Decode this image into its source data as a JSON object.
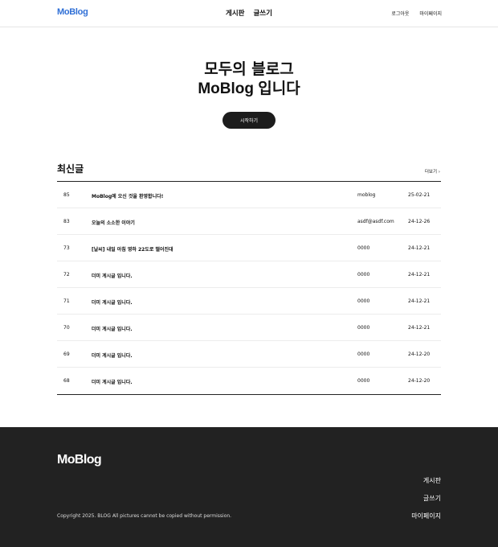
{
  "header": {
    "logo": "MoBlog",
    "nav": [
      "게시판",
      "글쓰기"
    ],
    "auth": [
      "로그아웃",
      "마이페이지"
    ]
  },
  "hero": {
    "line1": "모두의 블로그",
    "line2": "MoBlog 입니다",
    "button": "시작하기"
  },
  "recent": {
    "title": "최신글",
    "more": "더보기 ›",
    "posts": [
      {
        "num": "85",
        "title": "MoBlog에 오신 것을 환영합니다!",
        "author": "moblog",
        "date": "25-02-21"
      },
      {
        "num": "83",
        "title": "오늘의 소소한 이야기",
        "author": "asdf@asdf.com",
        "date": "24-12-26"
      },
      {
        "num": "73",
        "title": "[날씨] 내일 아침 영하 22도로 떨어진대",
        "author": "0000",
        "date": "24-12-21"
      },
      {
        "num": "72",
        "title": "더미 게시글 입니다.",
        "author": "0000",
        "date": "24-12-21"
      },
      {
        "num": "71",
        "title": "더미 게시글 입니다.",
        "author": "0000",
        "date": "24-12-21"
      },
      {
        "num": "70",
        "title": "더미 게시글 입니다.",
        "author": "0000",
        "date": "24-12-21"
      },
      {
        "num": "69",
        "title": "더미 게시글 입니다.",
        "author": "0000",
        "date": "24-12-20"
      },
      {
        "num": "68",
        "title": "더미 게시글 입니다.",
        "author": "0000",
        "date": "24-12-20"
      }
    ]
  },
  "footer": {
    "logo": "MoBlog",
    "links": [
      "게시판",
      "글쓰기",
      "마이페이지"
    ],
    "copyright": "Copyright 2025. BLOG All pictures cannot be copied without permission."
  },
  "colors": {
    "brand": "#2f6fd6",
    "dark": "#222222"
  }
}
